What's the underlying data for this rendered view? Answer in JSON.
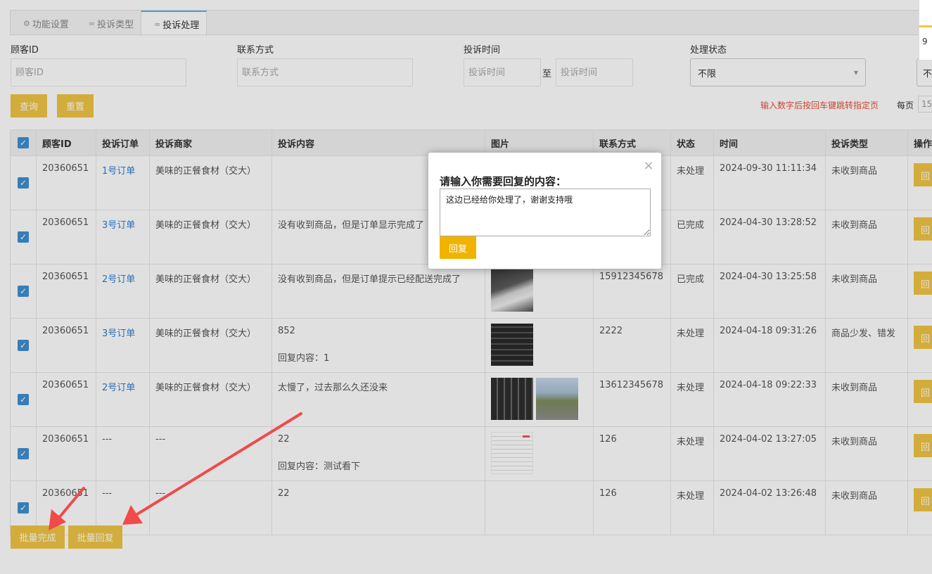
{
  "tabs": [
    {
      "label": "功能设置",
      "icon": "gear-icon"
    },
    {
      "label": "投诉类型",
      "icon": "link-icon"
    },
    {
      "label": "投诉处理",
      "icon": "link-icon",
      "active": true
    }
  ],
  "filters": {
    "customer_id": {
      "label": "顾客ID",
      "placeholder": "顾客ID"
    },
    "contact": {
      "label": "联系方式",
      "placeholder": "联系方式"
    },
    "time": {
      "label": "投诉时间",
      "start_placeholder": "投诉时间",
      "separator": "至",
      "end_placeholder": "投诉时间"
    },
    "status": {
      "label": "处理状态",
      "value": "不限"
    },
    "extra_value": "不"
  },
  "actions": {
    "query": "查询",
    "reset": "重置"
  },
  "pagination": {
    "hint": "输入数字后按回车键跳转指定页",
    "per_page_label": "每页",
    "per_page_value": "15"
  },
  "right_strip_text": "9",
  "table": {
    "headers": [
      "顾客ID",
      "投诉订单",
      "投诉商家",
      "投诉内容",
      "图片",
      "联系方式",
      "状态",
      "时间",
      "投诉类型",
      "操作"
    ],
    "op_label": "回",
    "rows": [
      {
        "id": "20360651",
        "order": "1号订单",
        "merchant": "美味的正餐食材（交大）",
        "content": "",
        "reply": "",
        "images": [],
        "contact": "",
        "status": "未处理",
        "time": "2024-09-30 11:11:34",
        "type": "未收到商品"
      },
      {
        "id": "20360651",
        "order": "3号订单",
        "merchant": "美味的正餐食材（交大）",
        "content": "没有收到商品，但是订单显示完成了",
        "reply": "",
        "images": [],
        "contact": "",
        "status": "已完成",
        "time": "2024-04-30 13:28:52",
        "type": "未收到商品"
      },
      {
        "id": "20360651",
        "order": "2号订单",
        "merchant": "美味的正餐食材（交大）",
        "content": "没有收到商品，但是订单提示已经配送完成了",
        "reply": "",
        "images": [
          "receipt"
        ],
        "contact": "15912345678",
        "status": "已完成",
        "time": "2024-04-30 13:25:58",
        "type": "未收到商品"
      },
      {
        "id": "20360651",
        "order": "3号订单",
        "merchant": "美味的正餐食材（交大）",
        "content": "852",
        "reply": "回复内容：1",
        "images": [
          "kbd"
        ],
        "contact": "2222",
        "status": "未处理",
        "time": "2024-04-18 09:31:26",
        "type": "商品少发、错发"
      },
      {
        "id": "20360651",
        "order": "2号订单",
        "merchant": "美味的正餐食材（交大）",
        "content": "太慢了，过去那么久还没来",
        "reply": "",
        "images": [
          "kbd2",
          "street"
        ],
        "contact": "13612345678",
        "status": "未处理",
        "time": "2024-04-18 09:22:33",
        "type": "未收到商品"
      },
      {
        "id": "20360651",
        "order": "---",
        "merchant": "---",
        "content": "22",
        "reply": "回复内容：测试看下",
        "images": [
          "doc"
        ],
        "contact": "126",
        "status": "未处理",
        "time": "2024-04-02 13:27:05",
        "type": "未收到商品"
      },
      {
        "id": "20360651",
        "order": "---",
        "merchant": "---",
        "content": "22",
        "reply": "",
        "images": [],
        "contact": "126",
        "status": "未处理",
        "time": "2024-04-02 13:26:48",
        "type": "未收到商品"
      }
    ]
  },
  "batch": {
    "complete": "批量完成",
    "reply": "批量回复"
  },
  "modal": {
    "title": "请输入你需要回复的内容：",
    "text": "这边已经给你处理了，谢谢支持哦",
    "submit": "回复"
  },
  "colors": {
    "accent": "#f0c545",
    "submit": "#f0b400",
    "link": "#2c7fd2",
    "hint": "#e8503a",
    "arrow": "#f04a4a"
  }
}
